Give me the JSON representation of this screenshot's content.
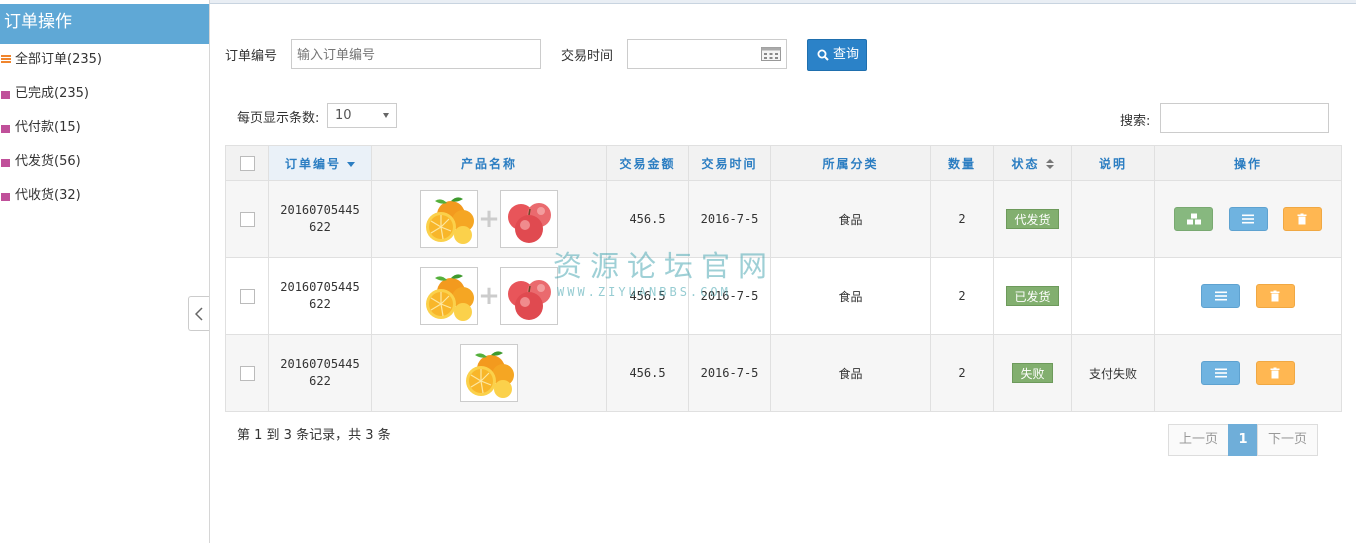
{
  "sidebar": {
    "title": "订单操作",
    "items": [
      {
        "label": "全部订单(235)"
      },
      {
        "label": "已完成(235)"
      },
      {
        "label": "代付款(15)"
      },
      {
        "label": "代发货(56)"
      },
      {
        "label": "代收货(32)"
      }
    ]
  },
  "search": {
    "order_no_label": "订单编号",
    "order_no_placeholder": "输入订单编号",
    "order_no_value": "",
    "trade_time_label": "交易时间",
    "trade_time_value": "",
    "query_button": "查询"
  },
  "page_size": {
    "label": "每页显示条数:",
    "selected": "10"
  },
  "table_search": {
    "label": "搜索:",
    "value": ""
  },
  "table": {
    "headers": [
      "订单编号",
      "产品名称",
      "交易金额",
      "交易时间",
      "所属分类",
      "数量",
      "状态",
      "说明",
      "操作"
    ],
    "rows": [
      {
        "order_no": "20160705445622",
        "amount": "456.5",
        "time": "2016-7-5",
        "category": "食品",
        "qty": "2",
        "status": "代发货",
        "note": ""
      },
      {
        "order_no": "20160705445622",
        "amount": "456.5",
        "time": "2016-7-5",
        "category": "食品",
        "qty": "2",
        "status": "已发货",
        "note": ""
      },
      {
        "order_no": "20160705445622",
        "amount": "456.5",
        "time": "2016-7-5",
        "category": "食品",
        "qty": "2",
        "status": "失败",
        "note": "支付失败"
      }
    ]
  },
  "footer": {
    "summary": "第 1 到 3 条记录，共 3 条",
    "prev": "上一页",
    "current": "1",
    "next": "下一页"
  },
  "watermark": {
    "line1": "资源论坛官网",
    "line2": "WWW.ZIYUANBBS.COM"
  },
  "colors": {
    "sidebar_header": "#5fa8d6",
    "query_button": "#2b82c8",
    "status_badge": "#82af6f",
    "action_green": "#87b87f",
    "action_blue": "#6fb3e0",
    "action_orange": "#ffb752",
    "header_text": "#2c7ec2"
  },
  "icons": {
    "sidebar_all": "list-icon",
    "sidebar_other": "tag-icon",
    "date_picker": "calendar-icon",
    "query": "search-icon",
    "collapse": "chevron-left-icon",
    "action_ship": "cubes-icon",
    "action_detail": "list-icon",
    "action_delete": "trash-icon"
  }
}
